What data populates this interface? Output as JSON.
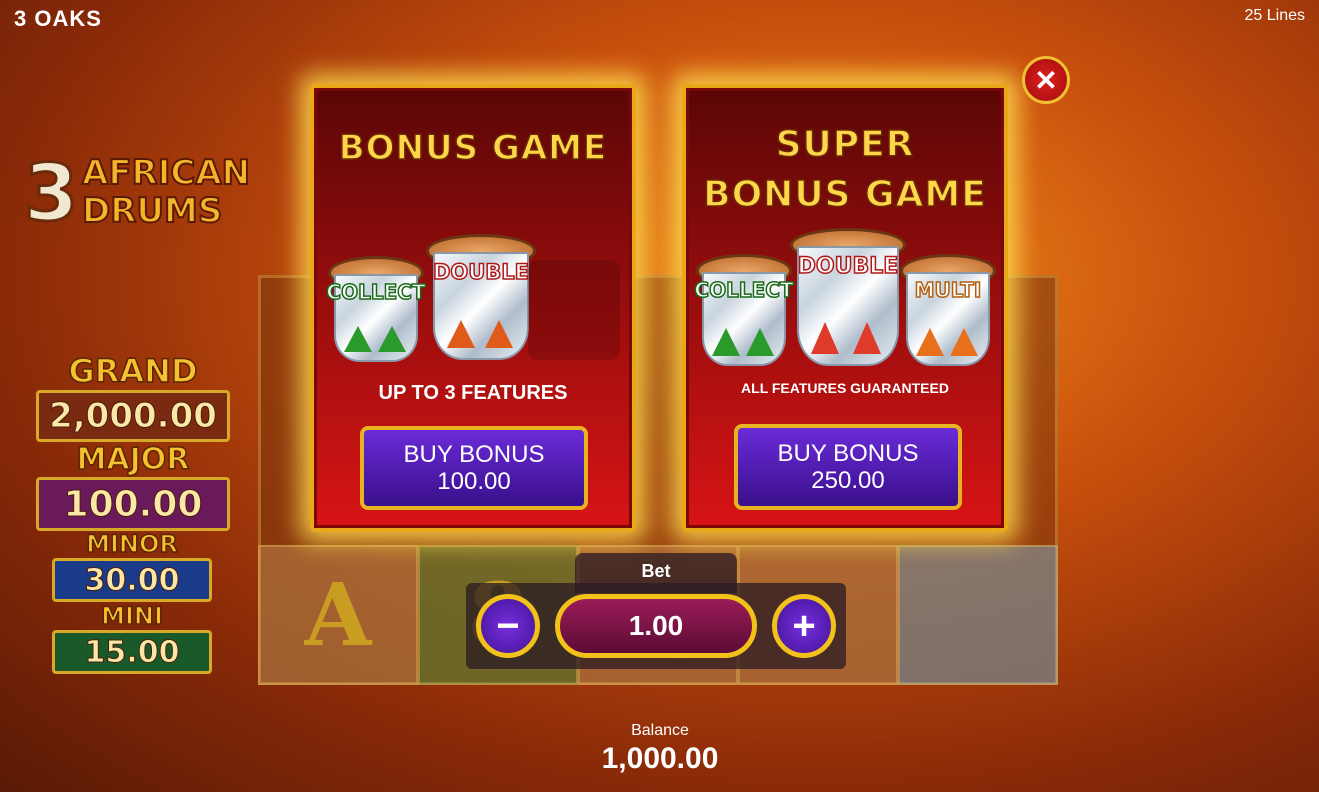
{
  "header": {
    "brand": "3 OAKS",
    "lines": "25 Lines"
  },
  "logo": {
    "number": "3",
    "line1": "AFRICAN",
    "line2": "DRUMS"
  },
  "jackpots": [
    {
      "name": "GRAND",
      "value": "2,000.00",
      "color": "#7a2a10"
    },
    {
      "name": "MAJOR",
      "value": "100.00",
      "color": "#6a1a5a"
    },
    {
      "name": "MINOR",
      "value": "30.00",
      "color": "#1a3a8a"
    },
    {
      "name": "MINI",
      "value": "15.00",
      "color": "#1a5a2a"
    }
  ],
  "reels": {
    "symbol_a": "A",
    "symbol_8": "8"
  },
  "bonus_game": {
    "title": "BONUS GAME",
    "features": "UP TO 3 FEATURES",
    "buy_label": "BUY BONUS",
    "price": "100.00",
    "drums": [
      "COLLECT",
      "DOUBLE"
    ]
  },
  "super_bonus_game": {
    "title_line1": "SUPER",
    "title_line2": "BONUS GAME",
    "features": "ALL FEATURES GUARANTEED",
    "buy_label": "BUY BONUS",
    "price": "250.00",
    "drums": [
      "COLLECT",
      "DOUBLE",
      "MULTI"
    ]
  },
  "close": {
    "icon": "close-icon",
    "glyph": "✕"
  },
  "bet": {
    "label": "Bet",
    "value": "1.00",
    "minus": "−",
    "plus": "+"
  },
  "balance": {
    "label": "Balance",
    "value": "1,000.00"
  },
  "colors": {
    "accent_gold": "#f2c21a",
    "panel_red": "#d81414",
    "button_purple": "#3a0f8c"
  }
}
